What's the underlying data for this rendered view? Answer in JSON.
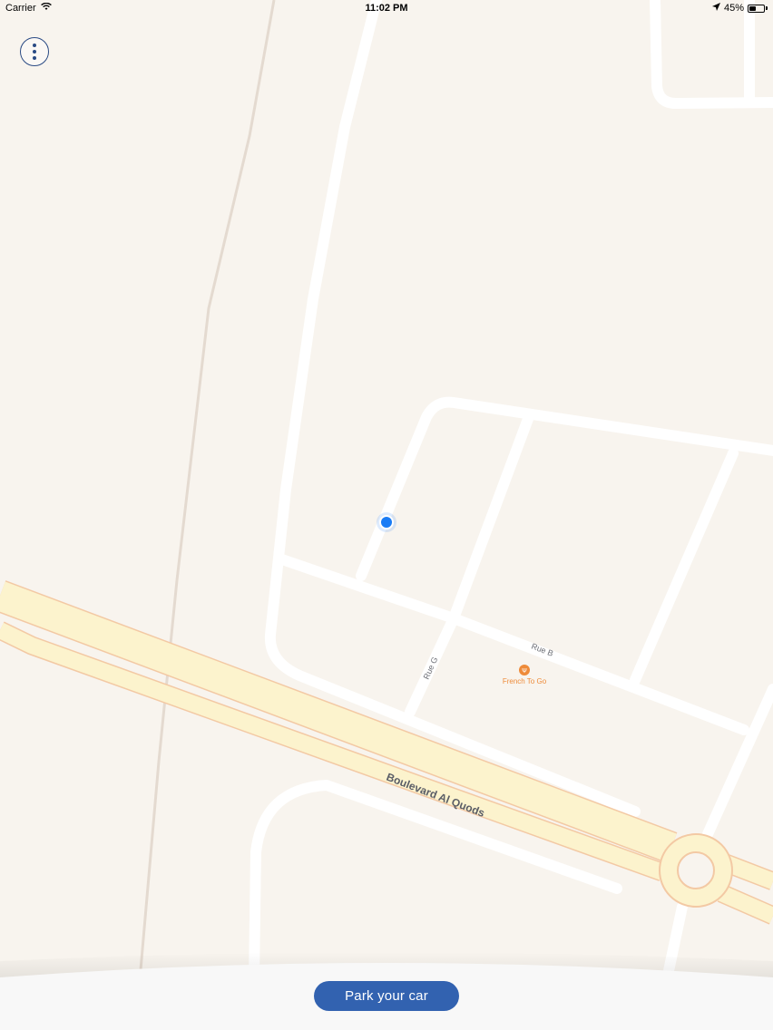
{
  "status_bar": {
    "carrier": "Carrier",
    "time": "11:02 PM",
    "battery_percent": "45%",
    "battery_level": 0.45,
    "icons": [
      "wifi-icon",
      "location-arrow-icon",
      "battery-icon"
    ]
  },
  "map": {
    "street_labels": {
      "boulevard": "Boulevard Al Quods",
      "rue_b": "Rue B",
      "rue_g": "Rue G"
    },
    "poi": {
      "name": "French To Go",
      "icon": "restaurant-icon"
    },
    "colors": {
      "land": "#f8f4ee",
      "road": "#ffffff",
      "highway_fill": "#fcf3cd",
      "highway_border": "#f3c9a4",
      "poi": "#ee8b3a",
      "user_location": "#1a7cf5"
    }
  },
  "menu_button": {
    "icon": "more-vertical-icon"
  },
  "park_button": {
    "label": "Park your car",
    "color": "#3262b0"
  }
}
